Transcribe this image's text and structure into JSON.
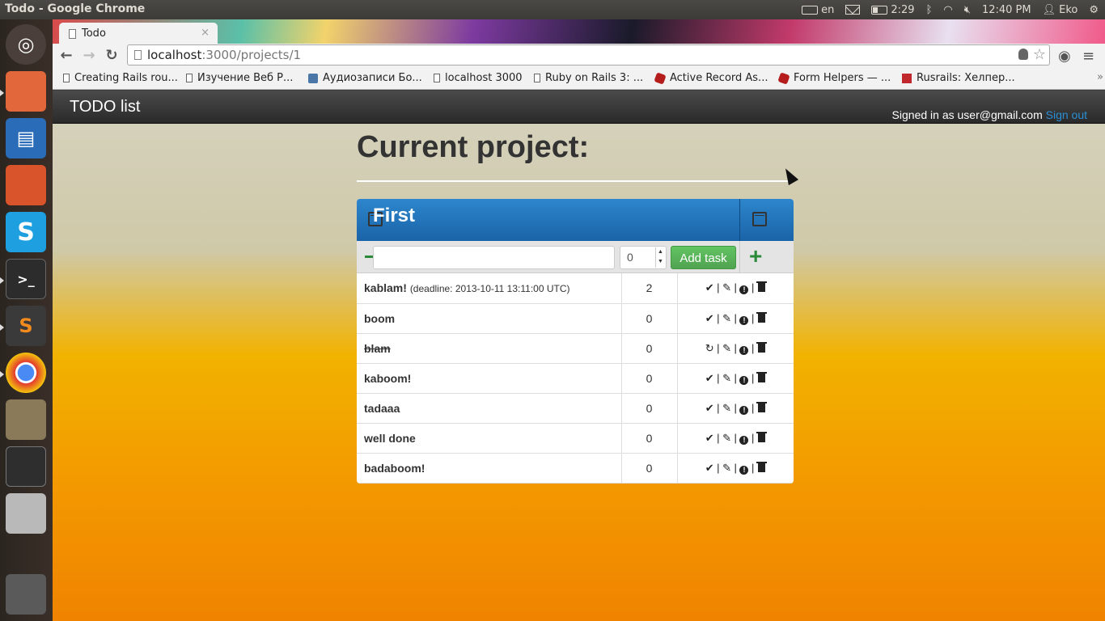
{
  "os": {
    "window_title": "Todo - Google Chrome",
    "keyboard_layout": "en",
    "battery_time": "2:29",
    "clock": "12:40 PM",
    "user": "Eko"
  },
  "browser": {
    "tab_title": "Todo",
    "url_host": "localhost",
    "url_rest": ":3000/projects/1",
    "bookmarks": [
      {
        "label": "Creating Rails rou...",
        "icon": "page-icon"
      },
      {
        "label": "Изучение Веб Р...",
        "icon": "page-icon"
      },
      {
        "label": "Аудиозаписи Бо...",
        "icon": "vk-icon"
      },
      {
        "label": "localhost 3000",
        "icon": "page-icon"
      },
      {
        "label": "Ruby on Rails 3: ...",
        "icon": "page-icon"
      },
      {
        "label": "Active Record As...",
        "icon": "ruby-icon"
      },
      {
        "label": "Form Helpers — ...",
        "icon": "ruby-icon"
      },
      {
        "label": "Rusrails: Хелпер...",
        "icon": "rusrails-icon"
      }
    ],
    "bookmarks_more": "»"
  },
  "app": {
    "brand": "TODO list",
    "signed_in_text": "Signed in as user@gmail.com",
    "sign_out": "Sign out",
    "page_heading": "Current project:",
    "project": {
      "name": "First",
      "priority_value": "0",
      "add_task_label": "Add task",
      "add_project_symbol": "+"
    },
    "tasks": [
      {
        "name": "kablam!",
        "deadline": "(deadline: 2013-10-11 13:11:00 UTC)",
        "priority": "2",
        "done": false
      },
      {
        "name": "boom",
        "deadline": "",
        "priority": "0",
        "done": false
      },
      {
        "name": "blam",
        "deadline": "",
        "priority": "0",
        "done": true
      },
      {
        "name": "kaboom!",
        "deadline": "",
        "priority": "0",
        "done": false
      },
      {
        "name": "tadaaa",
        "deadline": "",
        "priority": "0",
        "done": false
      },
      {
        "name": "well done",
        "deadline": "",
        "priority": "0",
        "done": false
      },
      {
        "name": "badaboom!",
        "deadline": "",
        "priority": "0",
        "done": false
      }
    ]
  },
  "colors": {
    "header_blue": "#1a63a8",
    "add_green": "#51a351",
    "link_blue": "#2a8fd6"
  }
}
